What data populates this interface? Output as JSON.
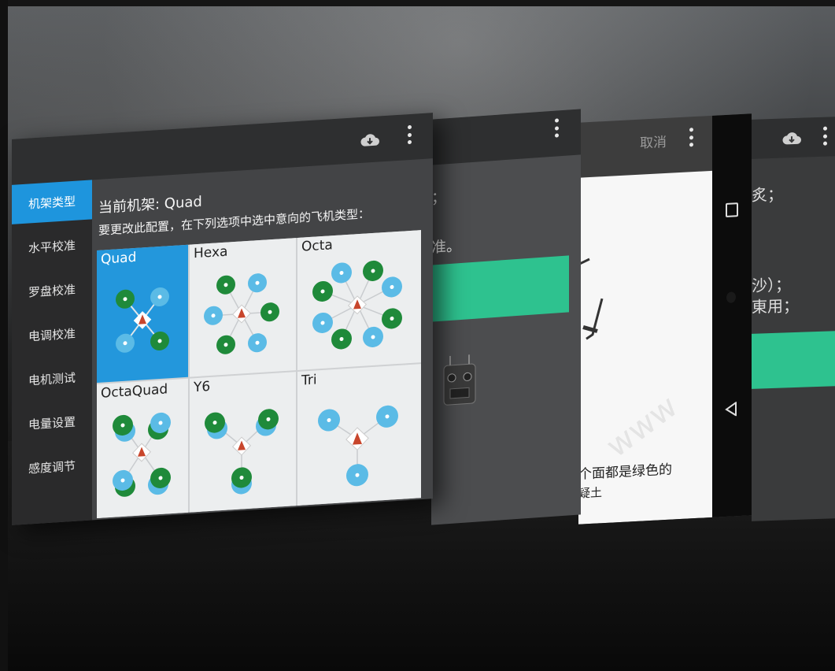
{
  "front": {
    "current_frame": "当前机架: Quad",
    "instruction": "要更改此配置，在下列选项中选中意向的飞机类型：",
    "sidebar": [
      {
        "label": "机架类型",
        "active": true
      },
      {
        "label": "水平校准",
        "active": false
      },
      {
        "label": "罗盘校准",
        "active": false
      },
      {
        "label": "电调校准",
        "active": false
      },
      {
        "label": "电机测试",
        "active": false
      },
      {
        "label": "电量设置",
        "active": false
      },
      {
        "label": "感度调节",
        "active": false
      }
    ],
    "frames": [
      {
        "label": "Quad",
        "selected": true
      },
      {
        "label": "Hexa",
        "selected": false
      },
      {
        "label": "Octa",
        "selected": false
      },
      {
        "label": "OctaQuad",
        "selected": false
      },
      {
        "label": "Y6",
        "selected": false
      },
      {
        "label": "Tri",
        "selected": false
      }
    ]
  },
  "panel2": {
    "text1": "；",
    "text2": "准。"
  },
  "panel3": {
    "cancel": "取消",
    "caption1": "个面都是绿色的",
    "caption2": "疑土"
  },
  "panel4": {
    "text1": "炙；",
    "text2": "沙）；",
    "text3": "東用；"
  },
  "colors": {
    "accent_blue": "#1e95dd",
    "teal": "#2ec28f",
    "rotor_green": "#1f8a3a",
    "rotor_light_blue": "#5bbbe6",
    "heading_arrow": "#c8462c"
  },
  "icons": [
    "menu-icon",
    "compass-icon",
    "cloud-download-icon",
    "overflow-menu-icon",
    "square-nav-icon",
    "back-nav-icon"
  ]
}
